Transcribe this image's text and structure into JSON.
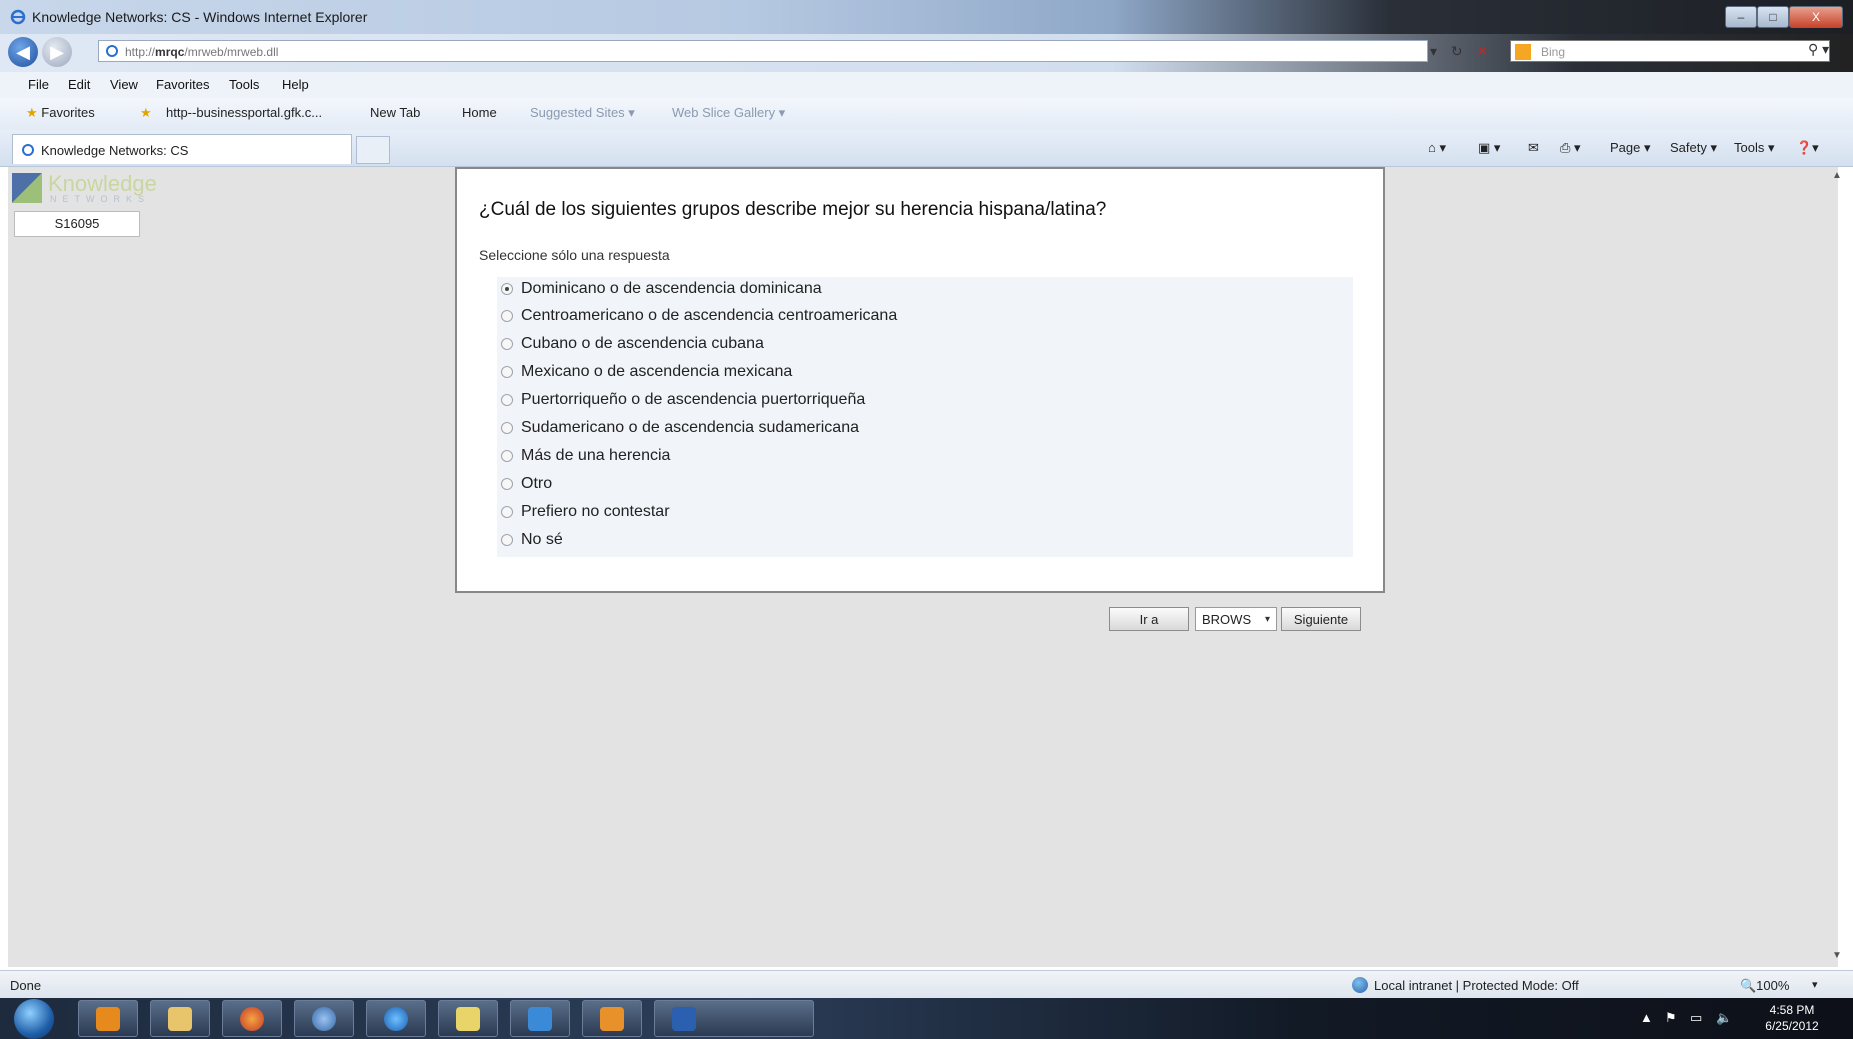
{
  "window": {
    "title": "Knowledge Networks: CS - Windows Internet Explorer",
    "minimize": "–",
    "maximize": "□",
    "close": "X"
  },
  "address": {
    "prefix": "http://",
    "host": "mrqc",
    "path": "/mrweb/mrweb.dll",
    "search_placeholder": "Bing"
  },
  "menu": [
    "File",
    "Edit",
    "View",
    "Favorites",
    "Tools",
    "Help"
  ],
  "favorites_bar": {
    "favorites_label": "Favorites",
    "items": [
      {
        "label": "http--businessportal.gfk.c...",
        "dim": false
      },
      {
        "label": "New Tab",
        "dim": false
      },
      {
        "label": "Home",
        "dim": false
      },
      {
        "label": "Suggested Sites ▾",
        "dim": true
      },
      {
        "label": "Web Slice Gallery ▾",
        "dim": true
      }
    ]
  },
  "tabs": {
    "active_label": "Knowledge Networks: CS"
  },
  "command_bar": {
    "page": "Page ▾",
    "safety": "Safety ▾",
    "tools": "Tools ▾",
    "help": "❓▾"
  },
  "sidebar": {
    "logo_word": "Knowledge",
    "logo_sub": "NETWORKS",
    "session_id": "S16095"
  },
  "question": {
    "title": "¿Cuál de los siguientes grupos describe mejor su herencia hispana/latina?",
    "instruction": "Seleccione sólo una respuesta",
    "options": [
      {
        "label": "Dominicano o de ascendencia dominicana",
        "checked": true
      },
      {
        "label": "Centroamericano o de ascendencia centroamericana",
        "checked": false
      },
      {
        "label": "Cubano o de ascendencia cubana",
        "checked": false
      },
      {
        "label": "Mexicano o de ascendencia mexicana",
        "checked": false
      },
      {
        "label": "Puertorriqueño o de ascendencia puertorriqueña",
        "checked": false
      },
      {
        "label": "Sudamericano o de ascendencia sudamericana",
        "checked": false
      },
      {
        "label": "Más de una herencia",
        "checked": false
      },
      {
        "label": "Otro",
        "checked": false
      },
      {
        "label": "Prefiero no contestar",
        "checked": false
      },
      {
        "label": "No sé",
        "checked": false
      }
    ]
  },
  "navigation": {
    "goto_label": "Ir a",
    "select_value": "BROWS",
    "next_label": "Siguiente"
  },
  "status": {
    "done": "Done",
    "zone": "Local intranet | Protected Mode: Off",
    "zoom": "🔍100%"
  },
  "taskbar": {
    "time": "4:58 PM",
    "date": "6/25/2012"
  },
  "colors": {
    "content_bg": "#e3e3e3",
    "options_bg": "#f1f4f9",
    "logo_blue": "#4f6fa8",
    "logo_green": "#9cc07a"
  }
}
